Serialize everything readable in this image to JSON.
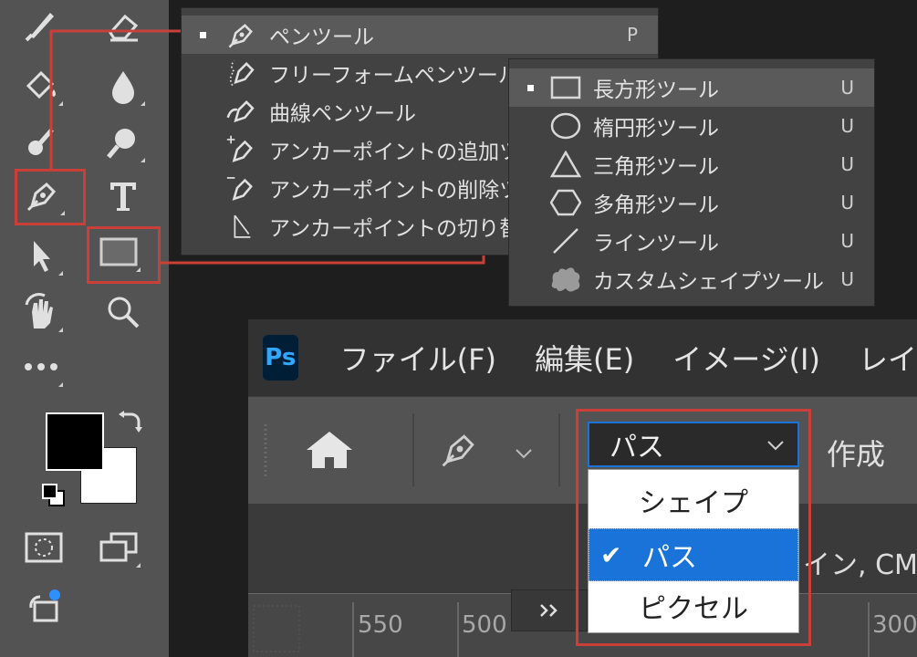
{
  "pen_flyout": {
    "items": [
      {
        "label": "ペンツール",
        "key": "P",
        "selected": true
      },
      {
        "label": "フリーフォームペンツール",
        "key": ""
      },
      {
        "label": "曲線ペンツール",
        "key": ""
      },
      {
        "label": "アンカーポイントの追加ツ",
        "key": ""
      },
      {
        "label": "アンカーポイントの削除ツ",
        "key": ""
      },
      {
        "label": "アンカーポイントの切り替",
        "key": ""
      }
    ]
  },
  "shape_flyout": {
    "items": [
      {
        "label": "長方形ツール",
        "key": "U",
        "selected": true,
        "icon": "rectangle-icon"
      },
      {
        "label": "楕円形ツール",
        "key": "U",
        "icon": "ellipse-icon"
      },
      {
        "label": "三角形ツール",
        "key": "U",
        "icon": "triangle-icon"
      },
      {
        "label": "多角形ツール",
        "key": "U",
        "icon": "polygon-icon"
      },
      {
        "label": "ラインツール",
        "key": "U",
        "icon": "line-icon"
      },
      {
        "label": "カスタムシェイプツール",
        "key": "U",
        "icon": "custom-shape-icon"
      }
    ]
  },
  "menubar": {
    "logo": "Ps",
    "items": [
      "ファイル(F)",
      "編集(E)",
      "イメージ(I)",
      "レイ"
    ]
  },
  "options": {
    "mode_value": "パス",
    "mode_options": [
      "シェイプ",
      "パス",
      "ピクセル"
    ],
    "create_label": "作成",
    "partial_text": "イン, CM"
  },
  "ruler": {
    "labels": [
      "550",
      "500",
      "300"
    ]
  },
  "colors": {
    "highlight": "#c9403a",
    "accent": "#1a73d9",
    "toolbar": "#535353"
  }
}
